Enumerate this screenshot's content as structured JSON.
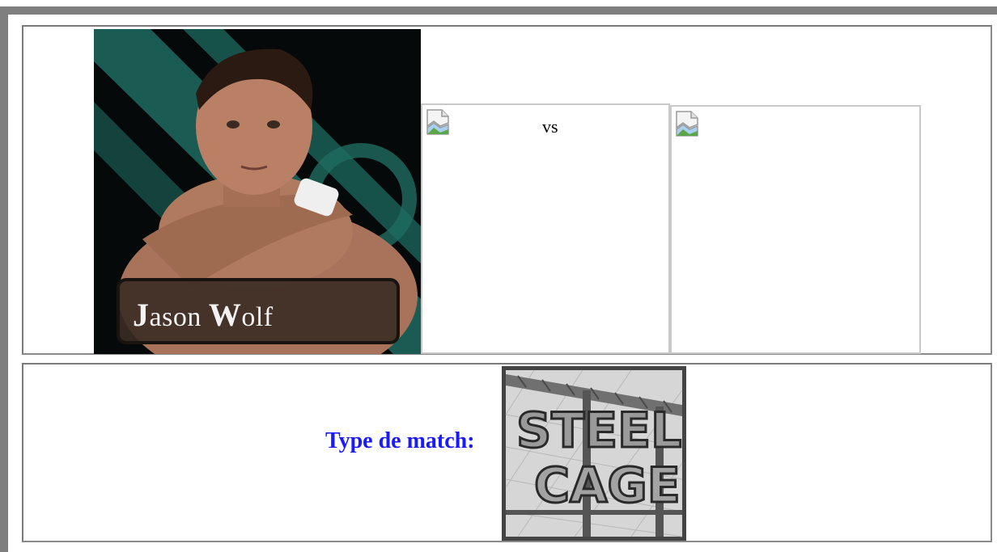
{
  "match_card": {
    "wrestler1": {
      "name_first_initial": "J",
      "name_first_rest": "ason",
      "name_last_initial": "W",
      "name_last_rest": "olf"
    },
    "vs_label": "vs",
    "match_type_label": "Type de match:",
    "match_type_line1": "STEEL",
    "match_type_line2": "CAGE"
  },
  "icons": {
    "broken_image_1": "broken-image-icon",
    "broken_image_2": "broken-image-icon"
  },
  "colors": {
    "frame": "#7f7f7f",
    "label_blue": "#1a1aff",
    "portrait_teal": "#1e6b60"
  }
}
